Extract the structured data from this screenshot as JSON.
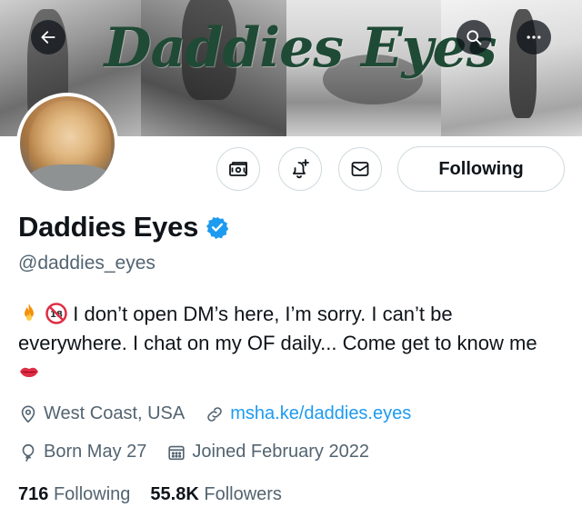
{
  "banner": {
    "title": "Daddies Eyes"
  },
  "top_actions": {
    "back": "arrow-left-icon",
    "search": "search-icon",
    "more": "more-horizontal-icon"
  },
  "actions": {
    "tip": "tip-money-icon",
    "notify": "bell-plus-icon",
    "message": "envelope-icon",
    "follow_label": "Following"
  },
  "profile": {
    "display_name": "Daddies Eyes",
    "verified": true,
    "handle": "@daddies_eyes",
    "bio": "I don’t open DM’s here, I’m sorry. I can’t be everywhere. I chat on my OF daily... Come get to know me",
    "bio_emoji_prefix": [
      "fire",
      "no-under-18"
    ],
    "bio_emoji_suffix": [
      "kiss-lips"
    ]
  },
  "meta": {
    "location": "West Coast, USA",
    "link": "msha.ke/daddies.eyes",
    "birthday": "Born May 27",
    "joined": "Joined February 2022"
  },
  "stats": {
    "following_count": "716",
    "following_label": "Following",
    "followers_count": "55.8K",
    "followers_label": "Followers"
  },
  "colors": {
    "accent": "#1d9bf0",
    "text_primary": "#0f1419",
    "text_secondary": "#536471",
    "banner_title": "#1f4a35"
  }
}
